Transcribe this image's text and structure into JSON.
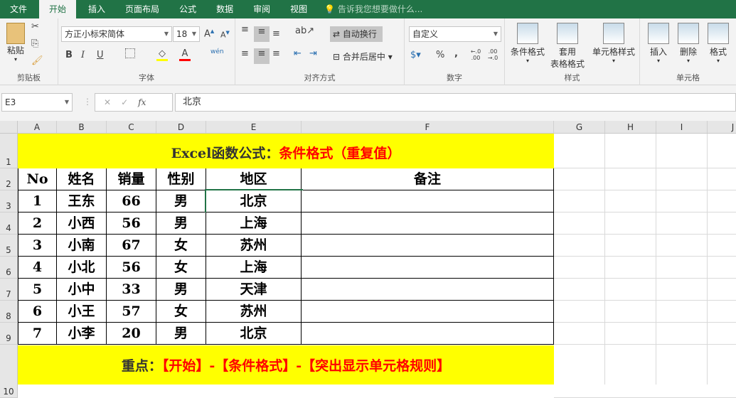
{
  "tabs": [
    "文件",
    "开始",
    "插入",
    "页面布局",
    "公式",
    "数据",
    "审阅",
    "视图"
  ],
  "tell_me": "告诉我您想要做什么...",
  "ribbon": {
    "clipboard": {
      "paste": "粘贴",
      "label": "剪贴板"
    },
    "font": {
      "name": "方正小标宋简体",
      "size": "18",
      "label": "字体",
      "bold": "B",
      "italic": "I",
      "underline": "U",
      "font_color": "A",
      "phonetic": "wén",
      "fill_color": "#ffff00",
      "text_color": "#ff0000"
    },
    "alignment": {
      "wrap": "自动换行",
      "merge": "合并后居中",
      "label": "对齐方式"
    },
    "number": {
      "format": "自定义",
      "percent": "%",
      "comma": ",",
      "inc": "←.0 .00",
      "dec": ".00 →.0",
      "label": "数字"
    },
    "styles": {
      "conditional": "条件格式",
      "table_l1": "套用",
      "table_l2": "表格格式",
      "cell_styles": "单元格样式",
      "label": "样式"
    },
    "cells": {
      "insert": "插入",
      "delete": "删除",
      "format": "格式",
      "label": "单元格"
    }
  },
  "formula_bar": {
    "name_box": "E3",
    "fx": "fx",
    "value": "北京"
  },
  "columns": [
    "A",
    "B",
    "C",
    "D",
    "E",
    "F",
    "G",
    "H",
    "I",
    "J"
  ],
  "rows": [
    "1",
    "2",
    "3",
    "4",
    "5",
    "6",
    "7",
    "8",
    "9",
    "10"
  ],
  "sheet": {
    "title_black": "Excel函数公式：",
    "title_red": "条件格式（重复值）",
    "headers": [
      "No",
      "姓名",
      "销量",
      "性别",
      "地区",
      "备注"
    ],
    "data": [
      [
        "1",
        "王东",
        "66",
        "男",
        "北京",
        ""
      ],
      [
        "2",
        "小西",
        "56",
        "男",
        "上海",
        ""
      ],
      [
        "3",
        "小南",
        "67",
        "女",
        "苏州",
        ""
      ],
      [
        "4",
        "小北",
        "56",
        "女",
        "上海",
        ""
      ],
      [
        "5",
        "小中",
        "33",
        "男",
        "天津",
        ""
      ],
      [
        "6",
        "小王",
        "57",
        "女",
        "苏州",
        ""
      ],
      [
        "7",
        "小李",
        "20",
        "男",
        "北京",
        ""
      ]
    ],
    "footer_black": "重点：",
    "footer_red": "【开始】-【条件格式】-【突出显示单元格规则】"
  }
}
